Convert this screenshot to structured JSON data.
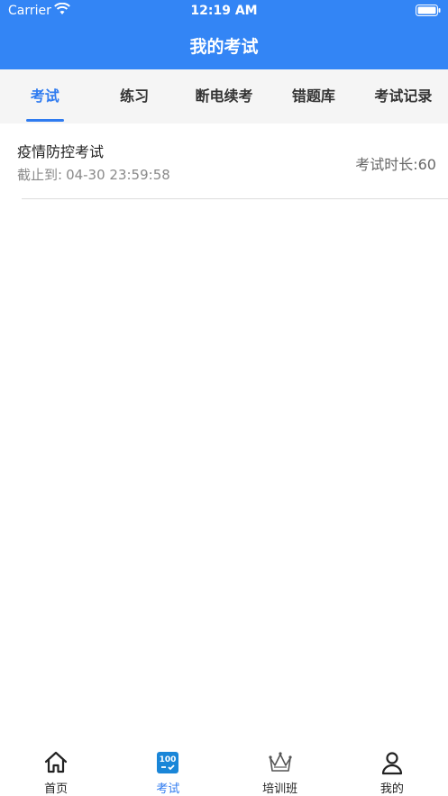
{
  "status_bar": {
    "carrier": "Carrier",
    "time": "12:19 AM"
  },
  "header": {
    "title": "我的考试"
  },
  "tabs": [
    {
      "label": "考试",
      "active": true
    },
    {
      "label": "练习",
      "active": false
    },
    {
      "label": "断电续考",
      "active": false
    },
    {
      "label": "错题库",
      "active": false
    },
    {
      "label": "考试记录",
      "active": false
    }
  ],
  "exams": [
    {
      "name": "疫情防控考试",
      "deadline_label": "截止到:",
      "deadline_value": "04-30 23:59:58",
      "duration": "考试时长:60"
    }
  ],
  "tabbar": [
    {
      "label": "首页",
      "icon": "home-icon",
      "active": false
    },
    {
      "label": "考试",
      "icon": "exam-100-icon",
      "active": true
    },
    {
      "label": "培训班",
      "icon": "crown-icon",
      "active": false
    },
    {
      "label": "我的",
      "icon": "person-icon",
      "active": false
    }
  ],
  "colors": {
    "header_bg": "#3385f5",
    "accent": "#2f7bf0",
    "tab_bg": "#f5f5f5"
  }
}
